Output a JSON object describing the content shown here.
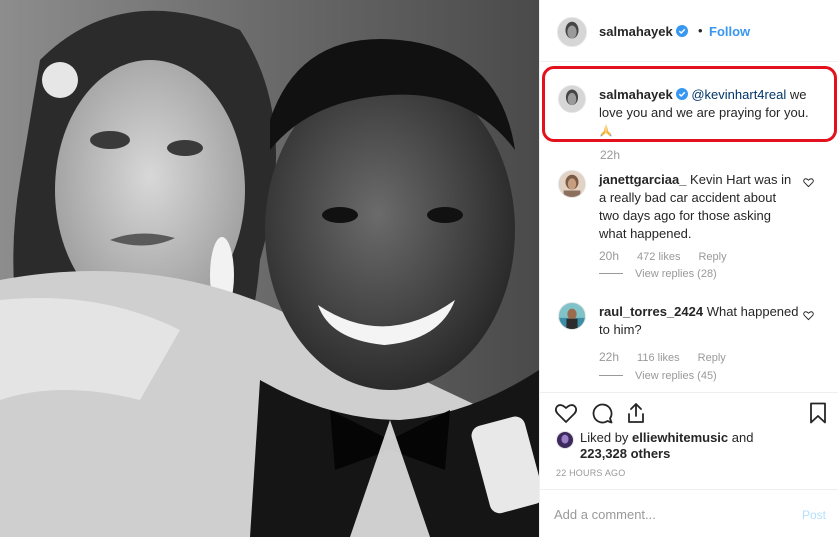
{
  "post": {
    "photo_description_icon": "photo-icon",
    "author": "salmahayek",
    "follow_separator": "•",
    "follow_label": "Follow"
  },
  "caption": {
    "username": "salmahayek",
    "mention": "@kevinhart4real",
    "text": " we love you and we are praying for you.",
    "emoji_icon": "praying-hands-icon",
    "time": "22h"
  },
  "comments": [
    {
      "username": "janettgarciaa_",
      "text": " Kevin Hart was in a really bad car accident about two days ago for those asking what happened.",
      "time": "20h",
      "likes": "472 likes",
      "reply_label": "Reply",
      "view_replies": "View replies (28)"
    },
    {
      "username": "raul_torres_2424",
      "text": " What happened to him?",
      "time": "22h",
      "likes": "116 likes",
      "reply_label": "Reply",
      "view_replies": "View replies (45)"
    }
  ],
  "likes": {
    "prefix": "Liked by ",
    "user": "elliewhitemusic",
    "middle": " and",
    "count": "223,328 others"
  },
  "timestamp": "22 HOURS AGO",
  "add_comment": {
    "placeholder": "Add a comment...",
    "post_label": "Post"
  },
  "colors": {
    "accent": "#3897f0",
    "highlight_border": "#e3101d",
    "muted": "#999999",
    "post_disabled": "#b2dffc"
  }
}
